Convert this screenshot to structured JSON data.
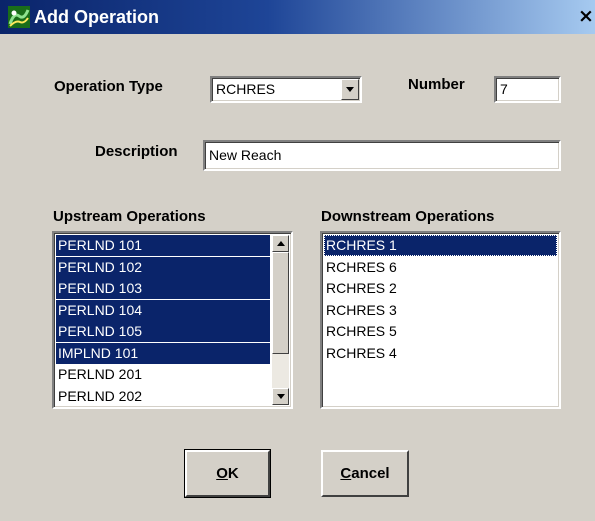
{
  "window": {
    "title": "Add Operation",
    "close_label": "×"
  },
  "form": {
    "operation_type_label": "Operation Type",
    "operation_type_value": "RCHRES",
    "number_label": "Number",
    "number_value": "7",
    "description_label": "Description",
    "description_value": "New Reach"
  },
  "upstream": {
    "label": "Upstream Operations",
    "items": [
      "PERLND 101",
      "PERLND 102",
      "PERLND 103",
      "PERLND 104",
      "PERLND 105",
      "IMPLND 101",
      "PERLND 201",
      "PERLND 202"
    ],
    "selected": [
      true,
      true,
      true,
      true,
      true,
      true,
      false,
      false
    ]
  },
  "downstream": {
    "label": "Downstream Operations",
    "items": [
      "RCHRES 1",
      "RCHRES 6",
      "RCHRES 2",
      "RCHRES 3",
      "RCHRES 5",
      "RCHRES 4"
    ],
    "selected": [
      true,
      false,
      false,
      false,
      false,
      false
    ]
  },
  "buttons": {
    "ok_mnemonic": "O",
    "ok_rest": "K",
    "cancel_mnemonic": "C",
    "cancel_rest": "ancel"
  },
  "colors": {
    "selection": "#0a246a",
    "face": "#d4d0c8"
  }
}
